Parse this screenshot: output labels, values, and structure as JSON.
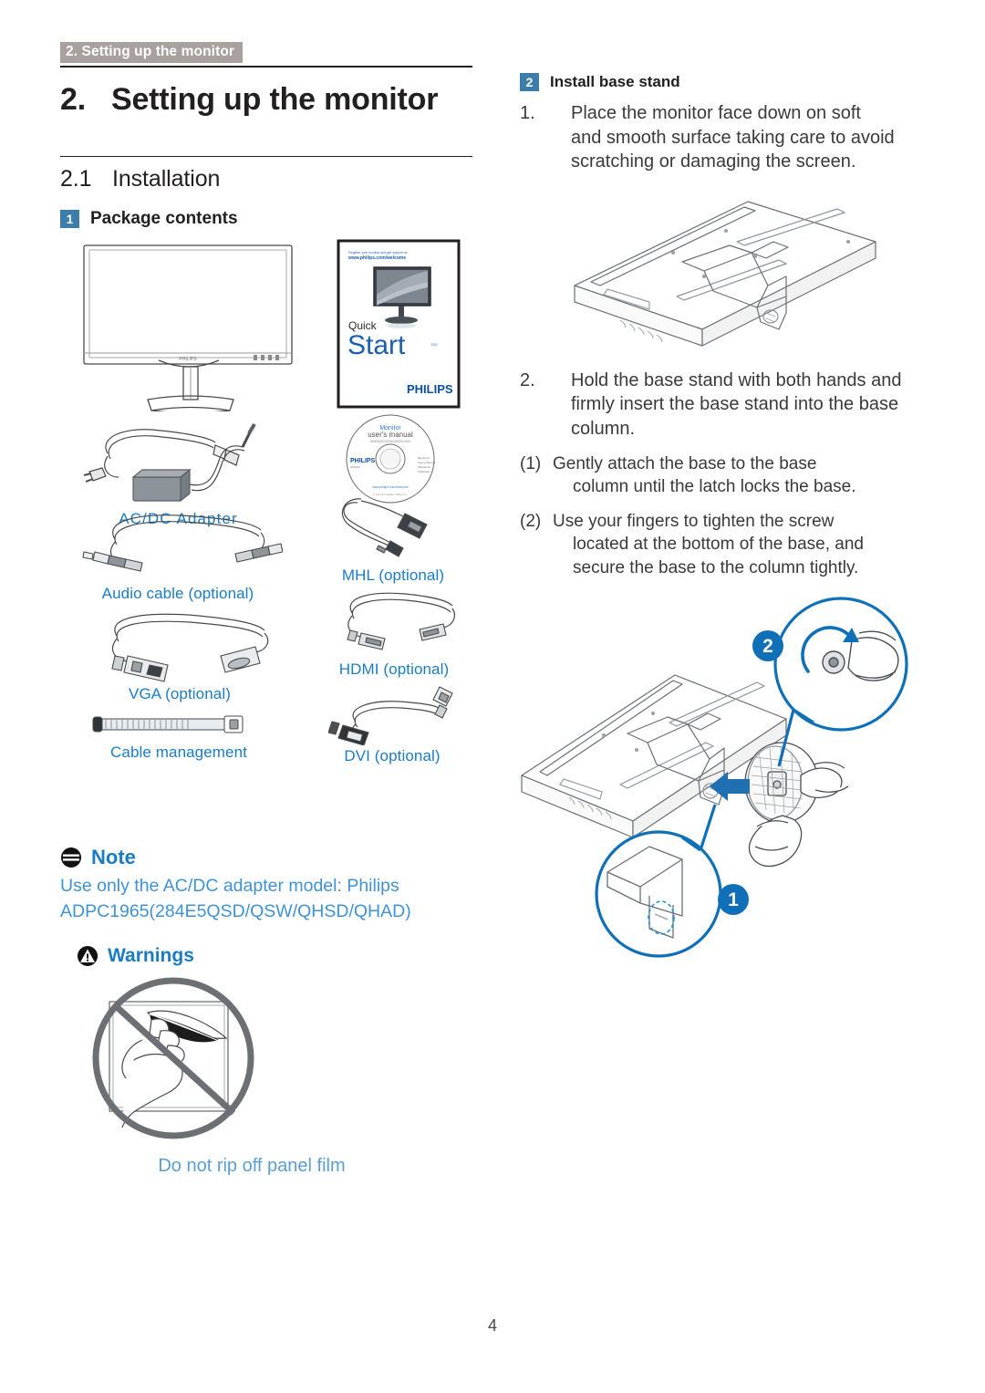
{
  "running_header": "2. Setting up the monitor",
  "chapter": {
    "number": "2.",
    "title": "Setting up the monitor"
  },
  "section": {
    "number": "2.1",
    "title": "Installation"
  },
  "left_column": {
    "package_contents": {
      "badge": "1",
      "heading": "Package contents",
      "items": [
        {
          "name": "monitor",
          "caption": ""
        },
        {
          "name": "quick-start-guide",
          "caption": "",
          "cover_lines": [
            "Register your product and get support at",
            "www.philips.com/welcome"
          ],
          "cover_quick": "Quick",
          "cover_start": "Start",
          "cover_brand": "PHILIPS"
        },
        {
          "name": "ac-dc-adapter",
          "caption": "AC/DC  Adapter"
        },
        {
          "name": "cd-user-manual",
          "caption": "",
          "disc_title": "Monitor",
          "disc_subtitle": "user's manual",
          "disc_brand": "PHILIPS"
        },
        {
          "name": "audio-cable",
          "caption": "Audio cable (optional)"
        },
        {
          "name": "mhl-cable",
          "caption": "MHL (optional)"
        },
        {
          "name": "vga-cable",
          "caption": "VGA (optional)"
        },
        {
          "name": "hdmi-cable",
          "caption": "HDMI (optional)"
        },
        {
          "name": "cable-management",
          "caption": "Cable management"
        },
        {
          "name": "dvi-cable",
          "caption": "DVI (optional)"
        }
      ]
    },
    "note": {
      "icon": "note-icon",
      "title": "Note",
      "line1": "Use only the AC/DC adapter model: Philips",
      "line2": "ADPC1965(284E5QSD/QSW/QHSD/QHAD)"
    },
    "warnings": {
      "icon": "warning-icon",
      "title": "Warnings",
      "caption": "Do not rip off panel film"
    }
  },
  "right_column": {
    "install_base_stand": {
      "badge": "2",
      "heading": "Install base stand"
    },
    "steps": [
      {
        "marker": "1.",
        "lines": [
          "Place the monitor face down on soft",
          "and smooth surface taking care to avoid",
          "scratching or damaging the screen."
        ]
      },
      {
        "marker": "2.",
        "lines": [
          "Hold the base stand with both hands and",
          "firmly insert the base stand into the base",
          "column."
        ]
      }
    ],
    "substeps": [
      {
        "marker": "(1)",
        "lines": [
          "Gently attach the base to the base",
          "column until the latch locks the base."
        ]
      },
      {
        "marker": "(2)",
        "lines": [
          "Use your fingers to tighten the screw",
          "located at the bottom of the base, and",
          "secure the base to the column tightly."
        ]
      }
    ],
    "callouts": [
      {
        "label": "2"
      },
      {
        "label": "1"
      }
    ]
  },
  "page_number": "4",
  "colors": {
    "accent_blue": "#1a7dc4",
    "badge_blue": "#3c7ea9",
    "header_gray": "#a8a19d",
    "caption_blue": "#1a7dc4",
    "text_dark": "#231f20",
    "body_gray": "#3a3a3a",
    "illustration_blue": "#0f70b7",
    "illustration_line": "#5c6670"
  }
}
